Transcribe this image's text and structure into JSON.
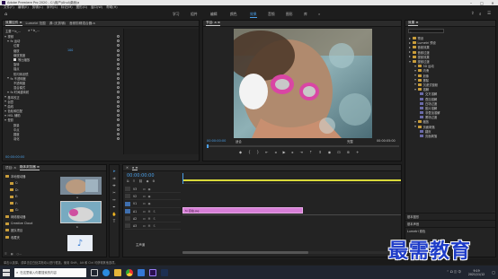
{
  "titlebar": {
    "title": "Adobe Premiere Pro 2020 - C:\\用户\\Ahui\\桌面\\a"
  },
  "menubar": {
    "items": [
      "文件(F)",
      "编辑(E)",
      "剪辑(C)",
      "序列(S)",
      "标记(M)",
      "图形(G)",
      "窗口(W)",
      "帮助(H)"
    ]
  },
  "workspaces": {
    "items": [
      "学习",
      "组件",
      "编辑",
      "颜色",
      "效果",
      "音频",
      "图形",
      "库"
    ],
    "active": "效果"
  },
  "effect_controls": {
    "tabs": [
      "效果控件 ≡",
      "Lumetri 范围",
      "源:(无剪辑)",
      "音频剪辑混合器:a"
    ],
    "source_label": "主要 * b_...",
    "sequence_label": "a * b_...",
    "rows": [
      {
        "label": "视频",
        "value": "",
        "kind": "section"
      },
      {
        "label": "fx 运动",
        "value": "",
        "kind": "group"
      },
      {
        "label": "位置",
        "value": "",
        "kind": "prop"
      },
      {
        "label": "缩放",
        "value": "100",
        "kind": "prop"
      },
      {
        "label": "缩放宽度",
        "value": "",
        "kind": "prop"
      },
      {
        "label": "等比缩放",
        "value": "",
        "kind": "check"
      },
      {
        "label": "旋转",
        "value": "",
        "kind": "prop"
      },
      {
        "label": "锚点",
        "value": "",
        "kind": "prop"
      },
      {
        "label": "防闪烁滤镜",
        "value": "",
        "kind": "prop"
      },
      {
        "label": "fx 不透明度",
        "value": "",
        "kind": "group"
      },
      {
        "label": "不透明度",
        "value": "",
        "kind": "prop"
      },
      {
        "label": "混合模式",
        "value": "",
        "kind": "prop"
      },
      {
        "label": "fx 时间重映射",
        "value": "",
        "kind": "group"
      },
      {
        "label": "基本校正",
        "value": "",
        "kind": "section"
      },
      {
        "label": "创意",
        "value": "",
        "kind": "section"
      },
      {
        "label": "曲线",
        "value": "",
        "kind": "section"
      },
      {
        "label": "色轮和匹配",
        "value": "",
        "kind": "section"
      },
      {
        "label": "HSL 辅助",
        "value": "",
        "kind": "section"
      },
      {
        "label": "晕影",
        "value": "",
        "kind": "section"
      },
      {
        "label": "数量",
        "value": "",
        "kind": "prop"
      },
      {
        "label": "中点",
        "value": "",
        "kind": "prop"
      },
      {
        "label": "圆度",
        "value": "",
        "kind": "prop"
      },
      {
        "label": "羽化",
        "value": "",
        "kind": "prop"
      }
    ],
    "timecode": "00:00:00:00"
  },
  "program": {
    "tab": "节目: a ≡",
    "timecode": "00:00:00:00",
    "fit_label": "适合",
    "fraction": "完整",
    "duration": "00:00:05:00"
  },
  "project": {
    "tabs": [
      "项目: a",
      "媒体浏览器 ≡"
    ],
    "search_placeholder": "",
    "items_count": "1 项",
    "tree": [
      "本地驱动器",
      "C:",
      "D:",
      "E:",
      "F:",
      "G:",
      "网络驱动器",
      "Creative Cloud",
      "团队项目",
      "收藏夹"
    ],
    "thumbs": [
      "a",
      "b",
      "c"
    ]
  },
  "timeline": {
    "tab": "a ≡",
    "timecode": "00:00:00:00",
    "tracks": [
      "V3",
      "V2",
      "V1",
      "A1",
      "A2",
      "A3"
    ],
    "clip_label": "fx 自拍.jpg",
    "master": "主声道"
  },
  "effects": {
    "tab": "效果 ≡",
    "search_placeholder": "",
    "tree": [
      {
        "label": "预设",
        "level": 0,
        "folder": true
      },
      {
        "label": "Lumetri 预设",
        "level": 0,
        "folder": true
      },
      {
        "label": "音频效果",
        "level": 0,
        "folder": true
      },
      {
        "label": "音频过渡",
        "level": 0,
        "folder": true
      },
      {
        "label": "视频效果",
        "level": 0,
        "folder": true
      },
      {
        "label": "视频过渡",
        "level": 0,
        "folder": true,
        "open": true
      },
      {
        "label": "3D 运动",
        "level": 1,
        "folder": true
      },
      {
        "label": "内滑",
        "level": 1,
        "folder": true
      },
      {
        "label": "划像",
        "level": 1,
        "folder": true
      },
      {
        "label": "擦除",
        "level": 1,
        "folder": true
      },
      {
        "label": "沉浸式视频",
        "level": 1,
        "folder": true
      },
      {
        "label": "溶解",
        "level": 1,
        "folder": true
      },
      {
        "label": "交叉溶解",
        "level": 2,
        "folder": false
      },
      {
        "label": "叠加溶解",
        "level": 2,
        "folder": false
      },
      {
        "label": "白场过渡",
        "level": 2,
        "folder": false
      },
      {
        "label": "胶片溶解",
        "level": 2,
        "folder": false
      },
      {
        "label": "非叠加溶解",
        "level": 2,
        "folder": false
      },
      {
        "label": "黑场过渡",
        "level": 2,
        "folder": false
      },
      {
        "label": "缩放",
        "level": 1,
        "folder": true
      },
      {
        "label": "页面剥落",
        "level": 1,
        "folder": true
      },
      {
        "label": "翻页",
        "level": 2,
        "folder": false
      },
      {
        "label": "页面剥落",
        "level": 2,
        "folder": false
      }
    ],
    "lower_tabs": [
      "基本图形",
      "基本声音",
      "Lumetri 颜色"
    ]
  },
  "statusbar": {
    "text": "单击以选择，或单击空白处并拖动以进行框选。使用 Shift、Alt 和 Ctrl 可获得其他选项。"
  },
  "watermark": "最需教育",
  "taskbar": {
    "search": "在这里输入你要搜索的内容",
    "time": "9:19",
    "date": "2021/11/12"
  },
  "colors": {
    "accent": "#4a9fe8",
    "clip": "#d77fd7",
    "timecode": "#5ba8ec",
    "workarea": "#d9d93a"
  }
}
